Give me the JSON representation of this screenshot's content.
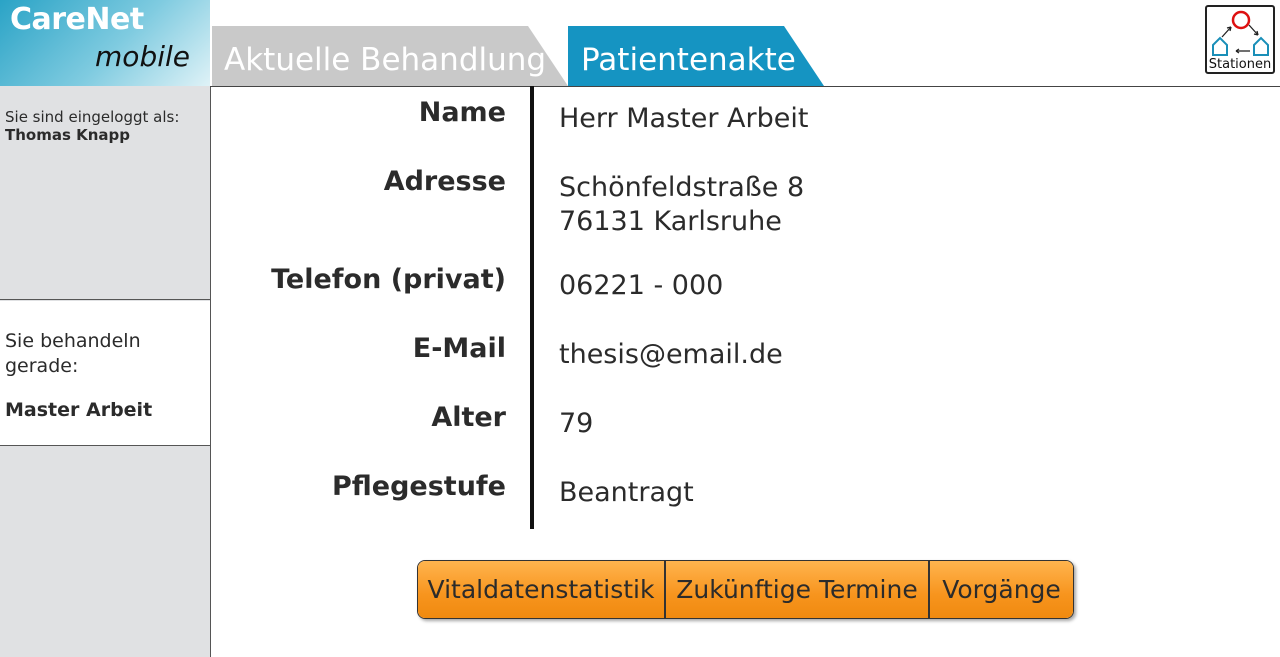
{
  "app": {
    "title": "CareNet",
    "subtitle": "mobile"
  },
  "sidebar": {
    "login_label": "Sie sind eingeloggt als:",
    "user_name": "Thomas Knapp",
    "treating_label": "Sie behandeln gerade:",
    "patient_name": "Master Arbeit"
  },
  "tabs": [
    {
      "label": "Aktuelle Behandlung",
      "active": false
    },
    {
      "label": "Patientenakte",
      "active": true
    }
  ],
  "stations_button": {
    "label": "Stationen",
    "icon": "stations-icon"
  },
  "record": {
    "name": {
      "label": "Name",
      "value": "Herr Master Arbeit"
    },
    "address": {
      "label": "Adresse",
      "line1": "Schönfeldstraße 8",
      "line2": "76131 Karlsruhe"
    },
    "phone": {
      "label": "Telefon (privat)",
      "value": "06221 - 000"
    },
    "email": {
      "label": "E-Mail",
      "value": "thesis@email.de"
    },
    "age": {
      "label": "Alter",
      "value": "79"
    },
    "care_level": {
      "label": "Pflegestufe",
      "value": "Beantragt"
    }
  },
  "actions": {
    "vitals": "Vitaldatenstatistik",
    "appointments": "Zukünftige Termine",
    "cases": "Vorgänge"
  },
  "colors": {
    "active_tab": "#1594c2",
    "inactive_tab": "#c9c9c9",
    "button": "#f7941d",
    "sidebar": "#e0e1e3"
  }
}
